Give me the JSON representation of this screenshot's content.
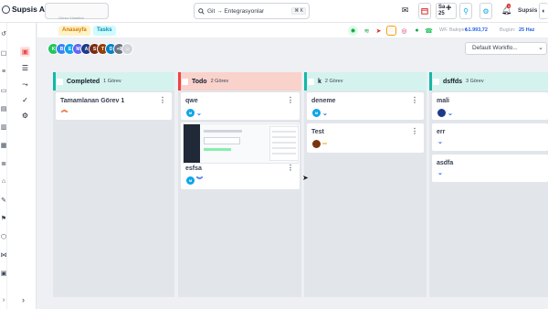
{
  "app": {
    "brand": "Supsis Ai",
    "tab_ghost": "Görev Yönetimi"
  },
  "search": {
    "value": "Git → Entegrasyonlar",
    "shortcut": "⌘ K"
  },
  "topbar": {
    "sa_label": "Sa",
    "sa_number": "25",
    "user": "Supsis",
    "bell_badge": "3"
  },
  "breadcrumb": {
    "home": "Anasayfa",
    "tasks": "Tasks"
  },
  "wallet": {
    "wf_label": "WF. Bakiye:",
    "wf_value": "₺1.993,72",
    "today_label": "Bugün:",
    "today_value": "25 Haz"
  },
  "avatars": {
    "more": "+6"
  },
  "workflow_select": {
    "value": "Default Workflo..."
  },
  "columns": [
    {
      "title": "Completed",
      "count": "1 Görev",
      "color": "#14b8a6",
      "head_bg": "#d5f3ee",
      "cards": [
        {
          "name": "Tamamlanan Görev 1"
        }
      ]
    },
    {
      "title": "Todo",
      "count": "2 Görev",
      "color": "#ef4444",
      "head_bg": "#f9d2cc",
      "cards": [
        {
          "name": "qwe",
          "avatar": "M"
        },
        {
          "name": "esfsa",
          "avatar": "M"
        }
      ]
    },
    {
      "title": "k",
      "count": "2 Görev",
      "color": "#14b8a6",
      "head_bg": "#d5f3ee",
      "cards": [
        {
          "name": "deneme",
          "avatar": "M"
        },
        {
          "name": "Test"
        }
      ]
    },
    {
      "title": "dsffds",
      "count": "3 Görev",
      "color": "#14b8a6",
      "head_bg": "#d5f3ee",
      "cards": [
        {
          "name": "mali"
        },
        {
          "name": "err"
        },
        {
          "name": "asdfa"
        }
      ]
    }
  ]
}
